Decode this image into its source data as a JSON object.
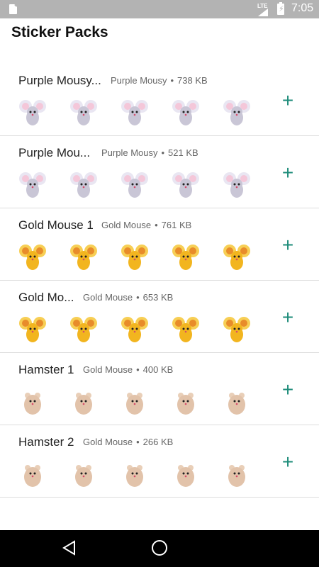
{
  "status_bar": {
    "time": "7:05",
    "network": "LTE"
  },
  "app_title": "Sticker Packs",
  "packs": [
    {
      "name": "Purple Mousy...",
      "publisher": "Purple Mousy",
      "dot": "•",
      "size": "738 KB",
      "theme": "mouse"
    },
    {
      "name": "Purple Mou...",
      "publisher": "Purple Mousy",
      "dot": "•",
      "size": "521 KB",
      "theme": "mouse"
    },
    {
      "name": "Gold Mouse 1",
      "publisher": "Gold Mouse",
      "dot": "•",
      "size": "761 KB",
      "theme": "gold"
    },
    {
      "name": "Gold Mo...",
      "publisher": "Gold Mouse",
      "dot": "•",
      "size": "653 KB",
      "theme": "gold"
    },
    {
      "name": "Hamster 1",
      "publisher": "Gold Mouse",
      "dot": "•",
      "size": "400 KB",
      "theme": "hamster"
    },
    {
      "name": "Hamster 2",
      "publisher": "Gold Mouse",
      "dot": "•",
      "size": "266 KB",
      "theme": "hamster"
    }
  ],
  "add_symbol": "+",
  "colors": {
    "accent": "#1e8c7a",
    "status_bar": "#b3b3b3",
    "nav_bar": "#000000"
  },
  "icons": {
    "back": "back-triangle-icon",
    "home": "home-circle-icon",
    "add": "plus-icon"
  }
}
